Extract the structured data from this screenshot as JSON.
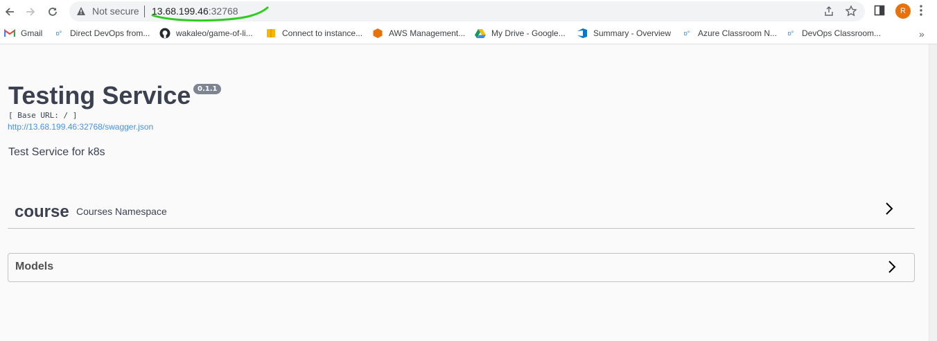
{
  "browser": {
    "security_label": "Not secure",
    "url_host": "13.68.199.46",
    "url_port": ":32768",
    "avatar_letter": "R",
    "bookmarks": [
      {
        "label": "Gmail",
        "icon": "gmail-icon"
      },
      {
        "label": "Direct DevOps from...",
        "icon": "devops-icon"
      },
      {
        "label": "wakaleo/game-of-li...",
        "icon": "github-icon"
      },
      {
        "label": "Connect to instance...",
        "icon": "cube-icon"
      },
      {
        "label": "AWS Management...",
        "icon": "aws-icon"
      },
      {
        "label": "My Drive - Google...",
        "icon": "drive-icon"
      },
      {
        "label": "Summary - Overview",
        "icon": "azure-devops-icon"
      },
      {
        "label": "Azure Classroom N...",
        "icon": "devops-icon"
      },
      {
        "label": "DevOps Classroom...",
        "icon": "devops-icon"
      }
    ],
    "more_bookmarks": "»"
  },
  "page": {
    "title": "Testing Service",
    "version": "0.1.1",
    "base_url": "[ Base URL: / ]",
    "spec_link": "http://13.68.199.46:32768/swagger.json",
    "description": "Test Service for k8s",
    "tag": {
      "name": "course",
      "description": "Courses Namespace"
    },
    "models_title": "Models"
  },
  "colors": {
    "link": "#4990e2",
    "version_badge": "#7d8492",
    "avatar": "#e8710a",
    "annotation": "#2ecc1f"
  }
}
